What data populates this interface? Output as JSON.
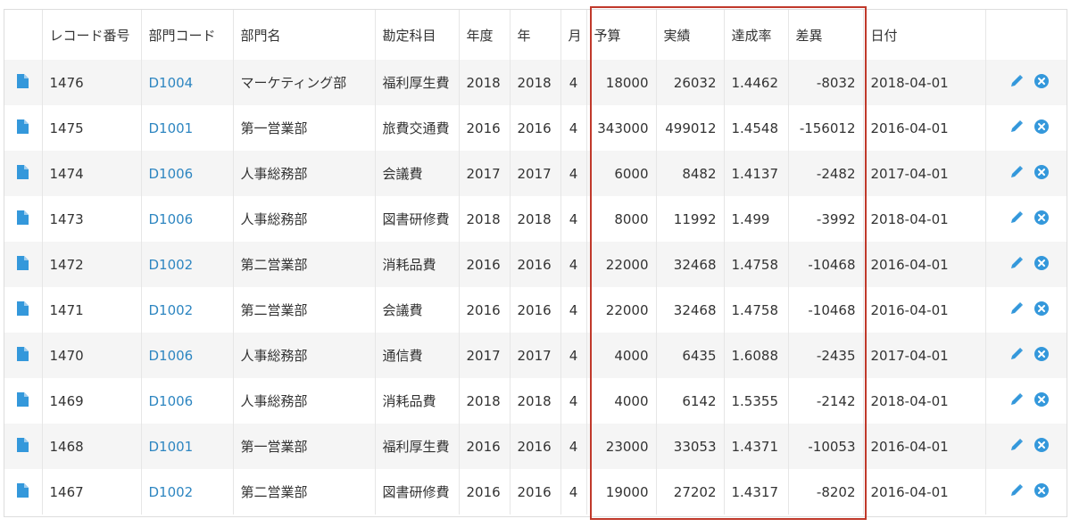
{
  "headers": [
    "",
    "レコード番号",
    "部門コード",
    "部門名",
    "勘定科目",
    "年度",
    "年",
    "月",
    "予算",
    "実績",
    "達成率",
    "差異",
    "日付",
    ""
  ],
  "rows": [
    {
      "record": "1476",
      "dept_code": "D1004",
      "dept_name": "マーケティング部",
      "account": "福利厚生費",
      "fiscal_year": "2018",
      "year": "2018",
      "month": "4",
      "budget": "18000",
      "actual": "26032",
      "rate": "1.4462",
      "diff": "-8032",
      "date": "2018-04-01"
    },
    {
      "record": "1475",
      "dept_code": "D1001",
      "dept_name": "第一営業部",
      "account": "旅費交通費",
      "fiscal_year": "2016",
      "year": "2016",
      "month": "4",
      "budget": "343000",
      "actual": "499012",
      "rate": "1.4548",
      "diff": "-156012",
      "date": "2016-04-01"
    },
    {
      "record": "1474",
      "dept_code": "D1006",
      "dept_name": "人事総務部",
      "account": "会議費",
      "fiscal_year": "2017",
      "year": "2017",
      "month": "4",
      "budget": "6000",
      "actual": "8482",
      "rate": "1.4137",
      "diff": "-2482",
      "date": "2017-04-01"
    },
    {
      "record": "1473",
      "dept_code": "D1006",
      "dept_name": "人事総務部",
      "account": "図書研修費",
      "fiscal_year": "2018",
      "year": "2018",
      "month": "4",
      "budget": "8000",
      "actual": "11992",
      "rate": "1.499",
      "diff": "-3992",
      "date": "2018-04-01"
    },
    {
      "record": "1472",
      "dept_code": "D1002",
      "dept_name": "第二営業部",
      "account": "消耗品費",
      "fiscal_year": "2016",
      "year": "2016",
      "month": "4",
      "budget": "22000",
      "actual": "32468",
      "rate": "1.4758",
      "diff": "-10468",
      "date": "2016-04-01"
    },
    {
      "record": "1471",
      "dept_code": "D1002",
      "dept_name": "第二営業部",
      "account": "会議費",
      "fiscal_year": "2016",
      "year": "2016",
      "month": "4",
      "budget": "22000",
      "actual": "32468",
      "rate": "1.4758",
      "diff": "-10468",
      "date": "2016-04-01"
    },
    {
      "record": "1470",
      "dept_code": "D1006",
      "dept_name": "人事総務部",
      "account": "通信費",
      "fiscal_year": "2017",
      "year": "2017",
      "month": "4",
      "budget": "4000",
      "actual": "6435",
      "rate": "1.6088",
      "diff": "-2435",
      "date": "2017-04-01"
    },
    {
      "record": "1469",
      "dept_code": "D1006",
      "dept_name": "人事総務部",
      "account": "消耗品費",
      "fiscal_year": "2018",
      "year": "2018",
      "month": "4",
      "budget": "4000",
      "actual": "6142",
      "rate": "1.5355",
      "diff": "-2142",
      "date": "2018-04-01"
    },
    {
      "record": "1468",
      "dept_code": "D1001",
      "dept_name": "第一営業部",
      "account": "福利厚生費",
      "fiscal_year": "2016",
      "year": "2016",
      "month": "4",
      "budget": "23000",
      "actual": "33053",
      "rate": "1.4371",
      "diff": "-10053",
      "date": "2016-04-01"
    },
    {
      "record": "1467",
      "dept_code": "D1002",
      "dept_name": "第二営業部",
      "account": "図書研修費",
      "fiscal_year": "2016",
      "year": "2016",
      "month": "4",
      "budget": "19000",
      "actual": "27202",
      "rate": "1.4317",
      "diff": "-8202",
      "date": "2016-04-01"
    }
  ],
  "icons": {
    "row_view": "document-icon",
    "edit": "pencil-icon",
    "delete": "close-circle-icon"
  },
  "colors": {
    "link": "#2e86c1",
    "icon": "#3498db",
    "highlight": "#c0392b",
    "stripe": "#f5f5f5"
  }
}
